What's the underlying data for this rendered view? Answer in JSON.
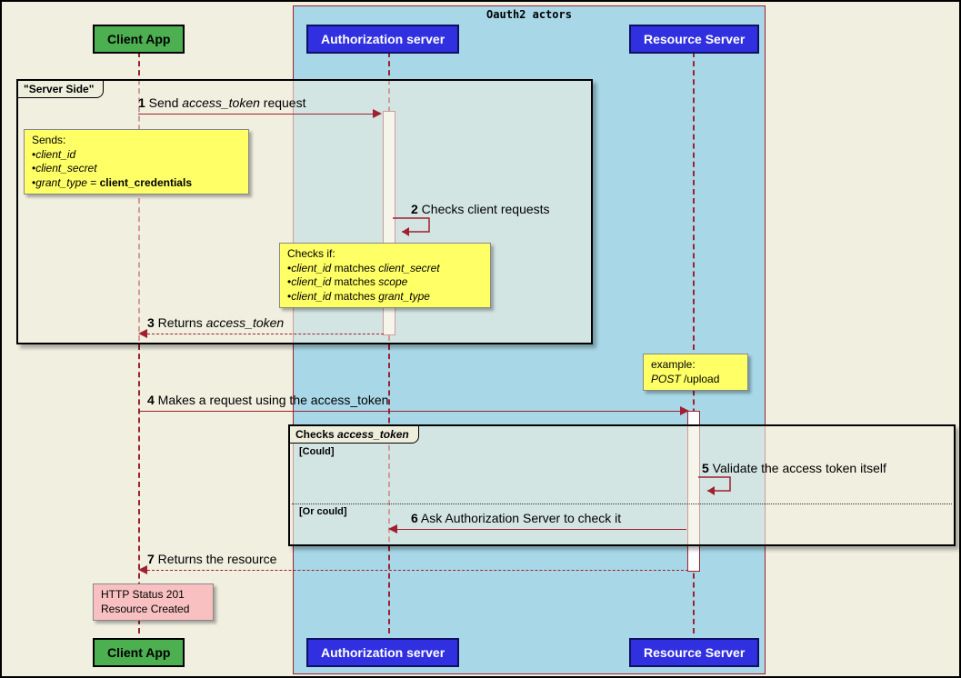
{
  "group": {
    "title": "Oauth2 actors"
  },
  "actors": {
    "client": "Client App",
    "auth": "Authorization server",
    "res": "Resource Server"
  },
  "frames": {
    "server_side": "\"Server Side\"",
    "checks_token_title": "Checks ",
    "checks_token_em": "access_token",
    "alt_could": "[Could]",
    "alt_or": "[Or could]"
  },
  "messages": {
    "m1_pre": "1",
    "m1_a": " Send ",
    "m1_em": "access_token",
    "m1_b": " request",
    "m2_pre": "2",
    "m2_a": " Checks client requests",
    "m3_pre": "3",
    "m3_a": " Returns ",
    "m3_em": "access_token",
    "m4_pre": "4",
    "m4_a": " Makes a request using the access_token",
    "m5_pre": "5",
    "m5_a": " Validate the access token itself",
    "m6_pre": "6",
    "m6_a": " Ask Authorization Server to check it",
    "m7_pre": "7",
    "m7_a": " Returns the resource"
  },
  "notes": {
    "sends_hdr": "Sends:",
    "sends_l1": "client_id",
    "sends_l2": "client_secret",
    "sends_l3a": "grant_type",
    "sends_l3b": " = ",
    "sends_l3c": "client_credentials",
    "checks_hdr": "Checks if:",
    "checks_l1a": "client_id",
    "checks_l1b": " matches ",
    "checks_l1c": "client_secret",
    "checks_l2a": "client_id",
    "checks_l2b": " matches ",
    "checks_l2c": "scope",
    "checks_l3a": "client_id",
    "checks_l3b": " matches ",
    "checks_l3c": "grant_type",
    "ex_l1": "example:",
    "ex_l2a": "POST",
    "ex_l2b": " /upload",
    "resp_l1": "HTTP Status 201",
    "resp_l2": "Resource Created"
  }
}
